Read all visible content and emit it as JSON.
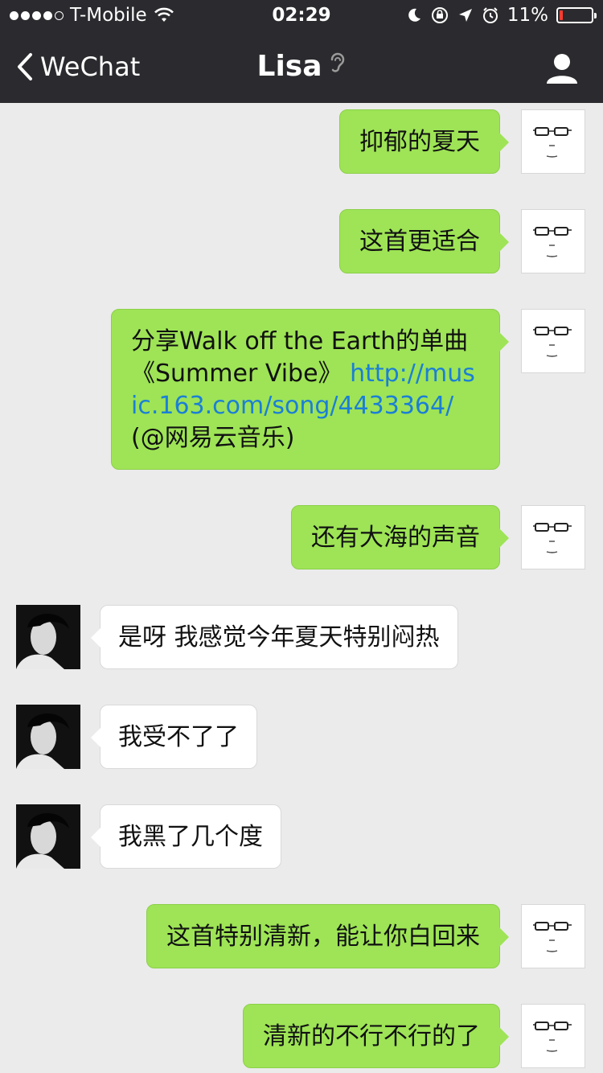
{
  "status": {
    "carrier": "T-Mobile",
    "time": "02:29",
    "battery": "11%"
  },
  "nav": {
    "back_label": "WeChat",
    "title": "Lisa"
  },
  "messages": [
    {
      "from": "me",
      "text": "抑郁的夏天"
    },
    {
      "from": "me",
      "text": "这首更适合"
    },
    {
      "from": "me",
      "text_before": "分享Walk off the Earth的单曲《Summer Vibe》",
      "link": "http://music.163.com/song/4433364/",
      "text_after": "(@网易云音乐)"
    },
    {
      "from": "me",
      "text": "还有大海的声音"
    },
    {
      "from": "lisa",
      "text": "是呀 我感觉今年夏天特别闷热"
    },
    {
      "from": "lisa",
      "text": "我受不了了"
    },
    {
      "from": "lisa",
      "text": "我黑了几个度"
    },
    {
      "from": "me",
      "text": "这首特别清新，能让你白回来"
    },
    {
      "from": "me",
      "text": "清新的不行不行的了"
    }
  ],
  "colors": {
    "me_bubble": "#9ee456",
    "lisa_bubble": "#ffffff",
    "nav_bg": "#2b2b2f",
    "chat_bg": "#ebebeb",
    "link": "#1b7fd6"
  }
}
